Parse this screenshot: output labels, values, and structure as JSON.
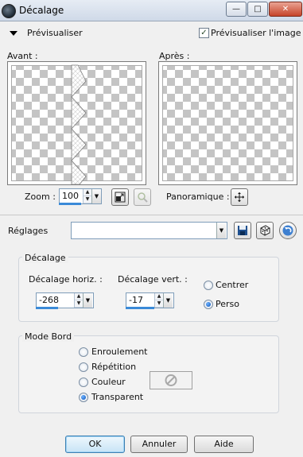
{
  "window": {
    "title": "Décalage",
    "buttons": {
      "minimize": "—",
      "maximize": "□",
      "close": "✕"
    }
  },
  "preview_header": {
    "toggle_label": "Prévisualiser",
    "checkbox_label": "Prévisualiser l'image",
    "checkbox_checked": true
  },
  "preview": {
    "before_label": "Avant :",
    "after_label": "Après :"
  },
  "zoom": {
    "label": "Zoom :",
    "value": "100",
    "pan_label": "Panoramique :"
  },
  "settings": {
    "label": "Réglages",
    "preset_value": ""
  },
  "offset_group": {
    "title": "Décalage",
    "horiz_label": "Décalage horiz. :",
    "horiz_value": "-268",
    "vert_label": "Décalage vert. :",
    "vert_value": "-17",
    "center_label": "Centrer",
    "custom_label": "Perso",
    "selected": "Perso"
  },
  "edge_group": {
    "title": "Mode Bord",
    "options": [
      "Enroulement",
      "Répétition",
      "Couleur",
      "Transparent"
    ],
    "selected": "Transparent"
  },
  "footer": {
    "ok": "OK",
    "cancel": "Annuler",
    "help": "Aide"
  }
}
